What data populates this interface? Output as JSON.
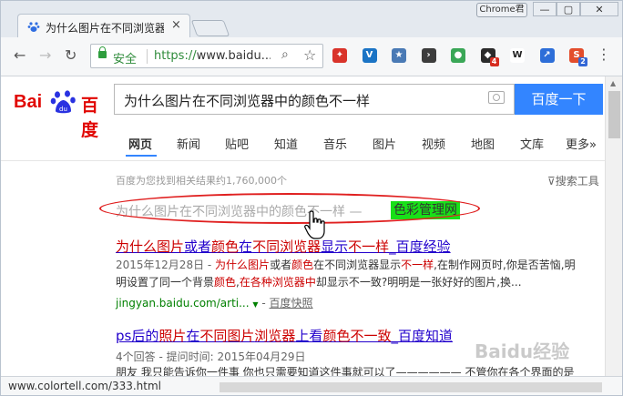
{
  "browser": {
    "tab_title": "为什么图片在不同浏览器",
    "tab_close": "×",
    "profile_label": "Chrome君",
    "window_controls": {
      "minimize": "—",
      "maximize": "▢",
      "close": "✕"
    },
    "secure_label": "安全",
    "url_scheme": "https://",
    "url_rest": "www.baidu....",
    "extensions": [
      {
        "name": "ext-red-icon",
        "color": "#d9332a",
        "glyph": "✦",
        "badge": ""
      },
      {
        "name": "ext-v-icon",
        "color": "#1b74c5",
        "glyph": "V",
        "badge": ""
      },
      {
        "name": "ext-star-icon",
        "color": "#4a7ab5",
        "glyph": "★",
        "badge": ""
      },
      {
        "name": "ext-arrow-icon",
        "color": "#3c3c3c",
        "glyph": "›",
        "badge": ""
      },
      {
        "name": "ext-green-dot-icon",
        "color": "#3aa757",
        "glyph": "●",
        "badge": ""
      },
      {
        "name": "ext-game-icon",
        "color": "#2b2b2b",
        "glyph": "◆",
        "badge": "4"
      },
      {
        "name": "ext-w-icon",
        "color": "#ffffff",
        "glyph": "W",
        "badge": ""
      },
      {
        "name": "ext-share-icon",
        "color": "#2d6ed8",
        "glyph": "↗",
        "badge": ""
      },
      {
        "name": "ext-s-icon",
        "color": "#e34d2c",
        "glyph": "S",
        "badge": "2"
      }
    ],
    "menu_glyph": "⋮",
    "status_url": "www.colortell.com/333.html"
  },
  "baidu": {
    "logo_bai": "Bai",
    "logo_du": "百度",
    "query": "为什么图片在不同浏览器中的颜色不一样",
    "search_button": "百度一下",
    "tabs": [
      "网页",
      "新闻",
      "贴吧",
      "知道",
      "音乐",
      "图片",
      "视频",
      "地图",
      "文库",
      "更多»"
    ],
    "result_count": "百度为您找到相关结果约1,760,000个",
    "search_tools": "搜索工具",
    "annotated_title": "为什么图片在不同浏览器中的颜色不一样 —",
    "highlight_text": "色彩管理网",
    "results": [
      {
        "title_parts": [
          "为什么图片",
          "或者",
          "颜色",
          "在",
          "不同浏览器",
          "显示",
          "不一样",
          "_百度经验"
        ],
        "snippet_line1_parts": [
          "2015年12月28日 - ",
          "为什么图片",
          "或者",
          "颜色",
          "在不同浏览器显示",
          "不一样",
          ",在制作网页时,你是否苦恼,明"
        ],
        "snippet_line2_parts": [
          "明设置了同一个背景",
          "颜色",
          ",",
          "在各种浏览器中",
          "却显示不一致?明明是一张好好的图片,换..."
        ],
        "url": "jingyan.baidu.com/arti...",
        "snapshot": "百度快照"
      },
      {
        "title_parts": [
          "ps后的",
          "照片",
          "在",
          "不同",
          "图片",
          "浏览器",
          "上看",
          "颜色不一致",
          "_百度知道"
        ],
        "meta": "4个回答 - 提问时间: 2015年04月29日",
        "snippet_line1": "朋友 我只能告诉你一件事 你也只需要知道这件事就可以了—————— 不管你在各个界面的是"
      }
    ],
    "watermark": "Baidu经验"
  }
}
